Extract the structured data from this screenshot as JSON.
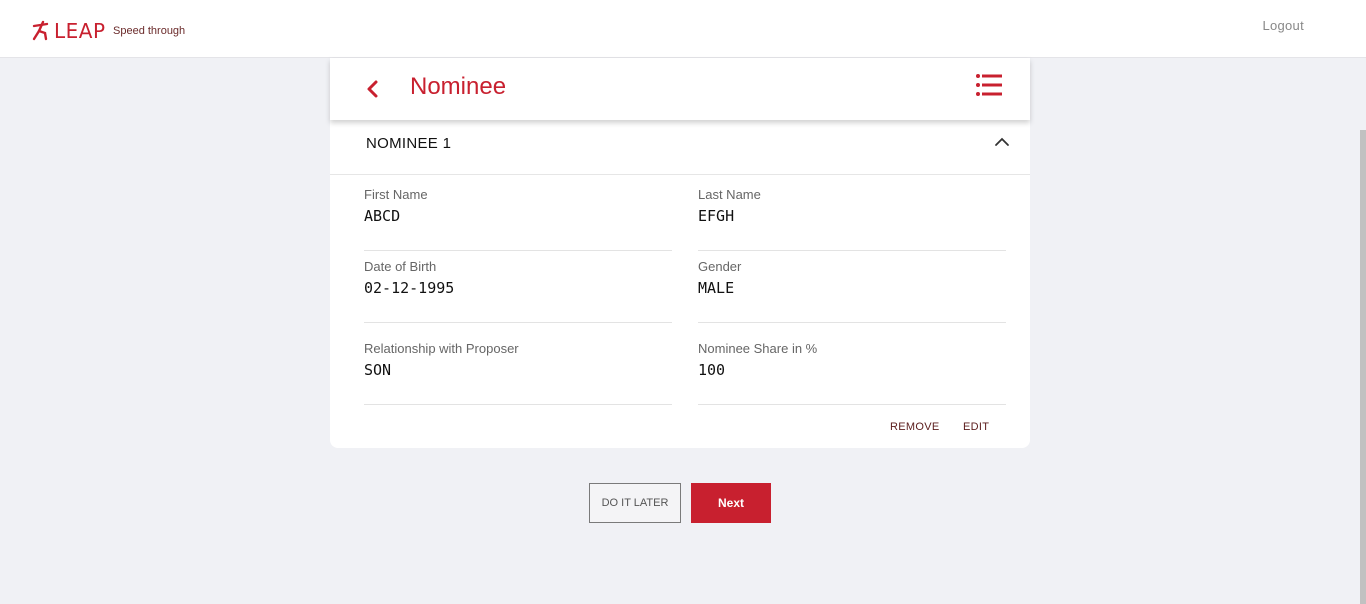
{
  "app": {
    "logo_text": "LEAP",
    "tagline": "Speed through",
    "logout_label": "Logout"
  },
  "header": {
    "title": "Nominee"
  },
  "section": {
    "title": "NOMINEE 1"
  },
  "fields": [
    {
      "label": "First Name",
      "value": "ABCD"
    },
    {
      "label": "Last Name",
      "value": "EFGH"
    },
    {
      "label": "Date of Birth",
      "value": "02-12-1995"
    },
    {
      "label": "Gender",
      "value": "MALE"
    },
    {
      "label": "Relationship with Proposer",
      "value": "SON"
    },
    {
      "label": "Nominee Share in %",
      "value": "100"
    }
  ],
  "actions": {
    "remove_label": "REMOVE",
    "edit_label": "EDIT"
  },
  "buttons": {
    "later_label": "DO IT LATER",
    "next_label": "Next"
  },
  "colors": {
    "accent": "#c8202f",
    "background": "#f0f1f5"
  },
  "icons": {
    "logo": "runner-icon",
    "back": "chevron-left-icon",
    "menu": "list-icon",
    "collapse": "chevron-up-icon"
  }
}
